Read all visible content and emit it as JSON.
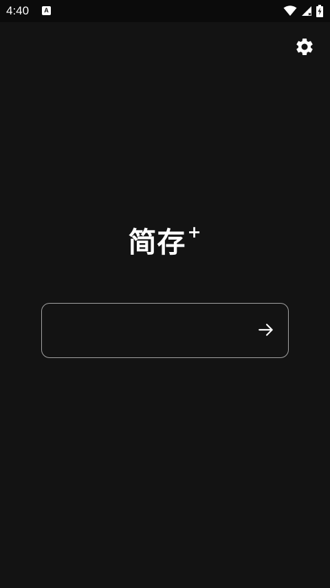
{
  "status_bar": {
    "time": "4:40",
    "notification_badge": "A",
    "icons": [
      "wifi-icon",
      "signal-icon",
      "battery-charging-icon"
    ]
  },
  "header": {
    "settings_icon": "gear-icon"
  },
  "main": {
    "title": "简存",
    "title_suffix": "+",
    "input": {
      "value": "",
      "placeholder": ""
    },
    "submit_icon": "arrow-right-icon"
  },
  "colors": {
    "background": "#131313",
    "status_bar": "#0b0b0b",
    "text": "#ffffff",
    "input_border": "#a3a3a3"
  }
}
